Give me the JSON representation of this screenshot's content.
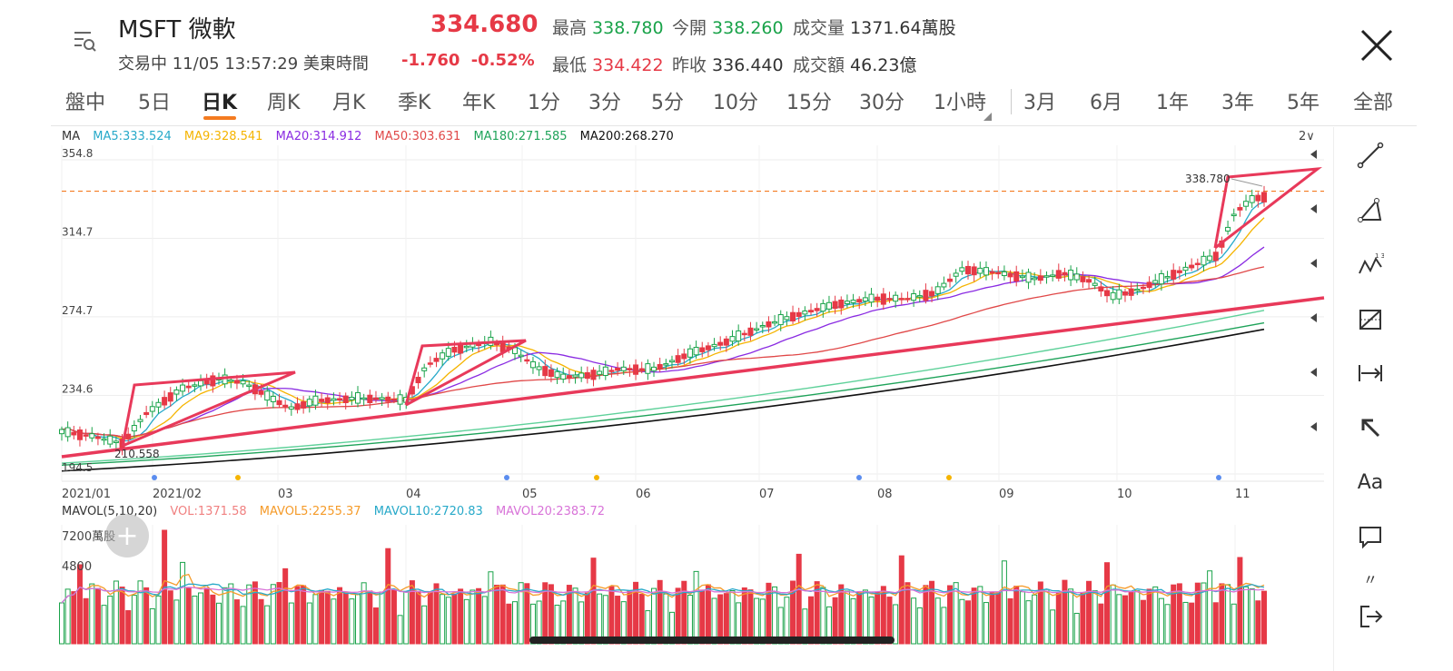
{
  "header": {
    "title": "MSFT 微軟",
    "status": "交易中 11/05 13:57:29 美東時間",
    "price": "334.680",
    "change": "-1.760",
    "change_pct": "-0.52%",
    "high_label": "最高",
    "high": "338.780",
    "open_label": "今開",
    "open": "338.260",
    "volume_label": "成交量",
    "volume": "1371.64萬股",
    "low_label": "最低",
    "low": "334.422",
    "prev_close_label": "昨收",
    "prev_close": "336.440",
    "turnover_label": "成交額",
    "turnover": "46.23億"
  },
  "tabs": [
    "盤中",
    "5日",
    "日K",
    "周K",
    "月K",
    "季K",
    "年K",
    "1分",
    "3分",
    "5分",
    "10分",
    "15分",
    "30分",
    "1小時",
    "3月",
    "6月",
    "1年",
    "3年",
    "5年",
    "全部"
  ],
  "active_tab": "日K",
  "ma_legend": {
    "label": "MA",
    "items": [
      {
        "text": "MA5:333.524",
        "color": "#27a9c9"
      },
      {
        "text": "MA9:328.541",
        "color": "#f5b400"
      },
      {
        "text": "MA20:314.912",
        "color": "#8a2be2"
      },
      {
        "text": "MA50:303.631",
        "color": "#e04848"
      },
      {
        "text": "MA180:271.585",
        "color": "#1fa35a"
      },
      {
        "text": "MA200:268.270",
        "color": "#111111"
      }
    ],
    "toggle": "2∨"
  },
  "vol_legend": {
    "label": "MAVOL(5,10,20)",
    "items": [
      {
        "text": "VOL:1371.58",
        "color": "#f08080"
      },
      {
        "text": "MAVOL5:2255.37",
        "color": "#f59b2a"
      },
      {
        "text": "MAVOL10:2720.83",
        "color": "#27a9c9"
      },
      {
        "text": "MAVOL20:2383.72",
        "color": "#d873d8"
      }
    ]
  },
  "chart_data": {
    "type": "candlestick",
    "y_ticks": [
      "354.8",
      "314.7",
      "274.7",
      "234.6",
      "194.5"
    ],
    "ylim": [
      194.5,
      354.8
    ],
    "x_ticks": [
      "2021/01",
      "2021/02",
      "03",
      "04",
      "05",
      "06",
      "07",
      "08",
      "09",
      "10",
      "11"
    ],
    "annotations": {
      "high": "338.780",
      "low": "210.558"
    },
    "volume_ticks": [
      "7200萬股",
      "4800"
    ],
    "colors": {
      "up": "#1aa34a",
      "down": "#e63946",
      "drawing": "#e8395a",
      "dashed": "#f47b20"
    }
  },
  "toolbar": {
    "tools": [
      "line-tool-icon",
      "triangle-tool-icon",
      "wave-tool-icon",
      "fib-tool-icon",
      "measure-tool-icon",
      "arrow-tool-icon",
      "text-tool-icon",
      "comment-tool-icon",
      "exit-tool-icon"
    ],
    "text_tool": "Aa",
    "more": "〃"
  }
}
